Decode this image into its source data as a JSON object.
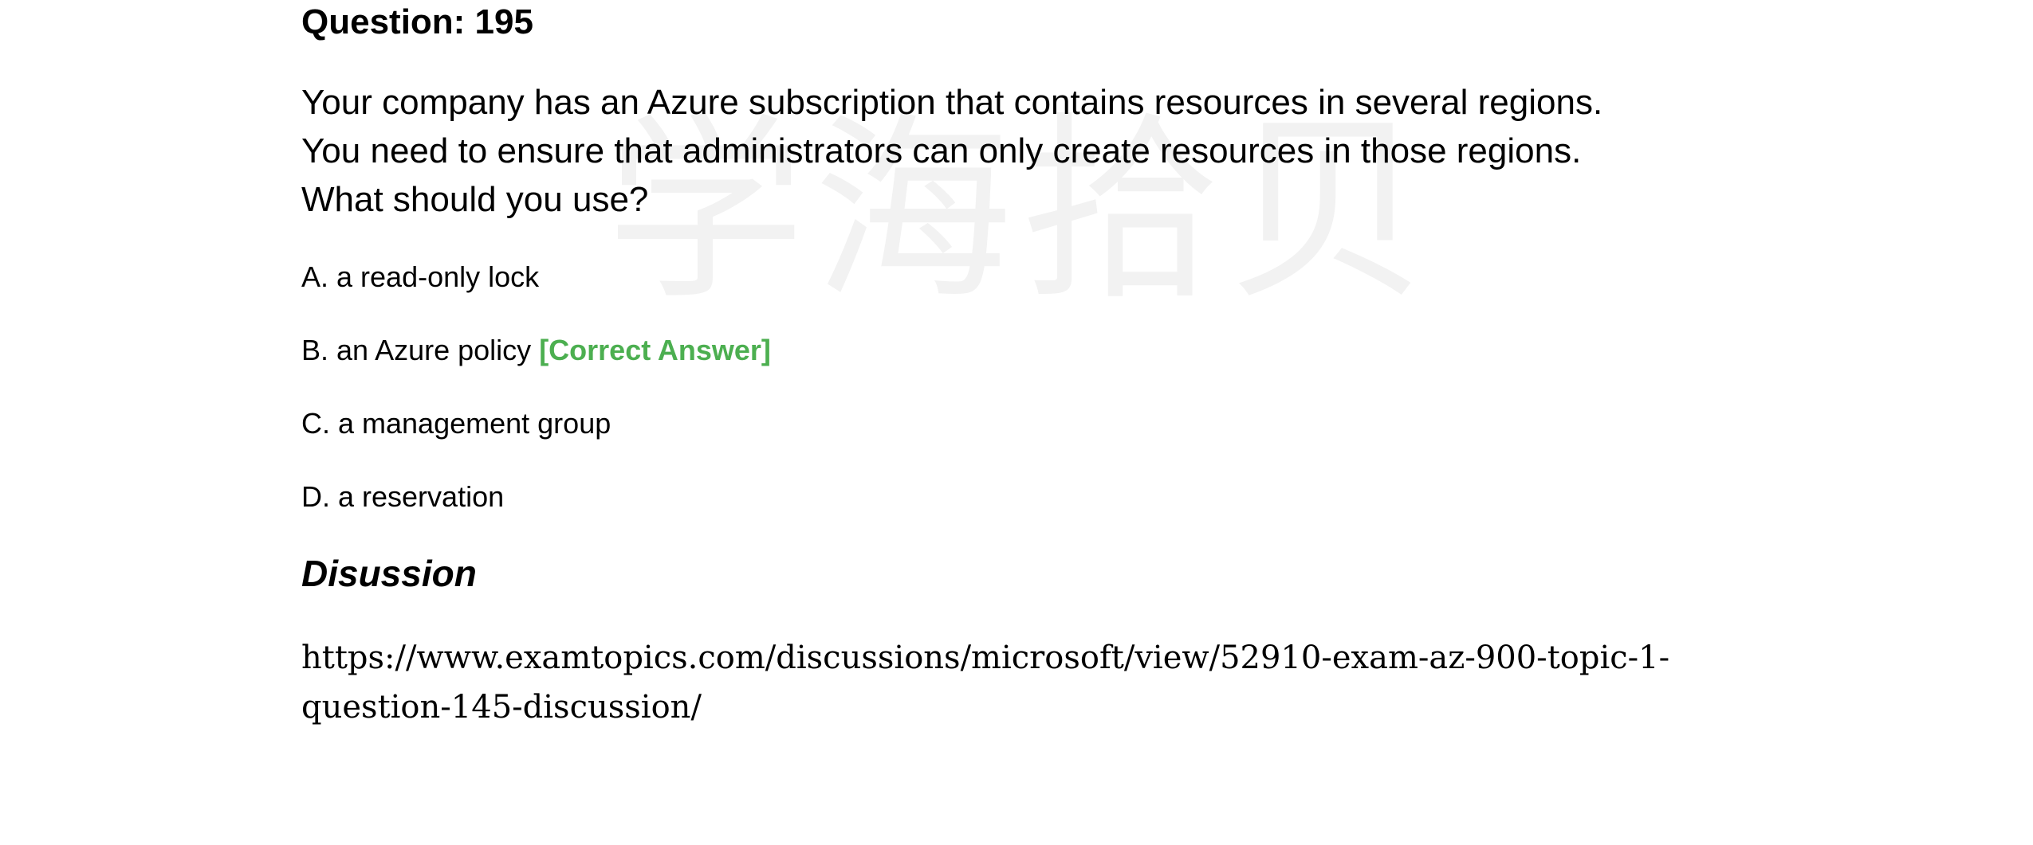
{
  "watermark": "学海拾贝",
  "question": {
    "title": "Question: 195",
    "lines": [
      "Your company has an Azure subscription that contains resources in several regions.",
      "You need to ensure that administrators can only create resources in those regions.",
      "What should you use?"
    ]
  },
  "options": [
    {
      "text": "A. a read-only lock",
      "tag": ""
    },
    {
      "text": "B. an Azure policy",
      "tag": "[Correct Answer]"
    },
    {
      "text": "C. a management group",
      "tag": ""
    },
    {
      "text": "D. a reservation",
      "tag": ""
    }
  ],
  "discussion": {
    "heading": "Disussion",
    "link_line1": "https://www.examtopics.com/discussions/microsoft/view/52910-exam-az-900-topic-1-",
    "link_line2": "question-145-discussion/"
  },
  "colors": {
    "correct": "#4caf50",
    "watermark": "#f2f2f2"
  }
}
